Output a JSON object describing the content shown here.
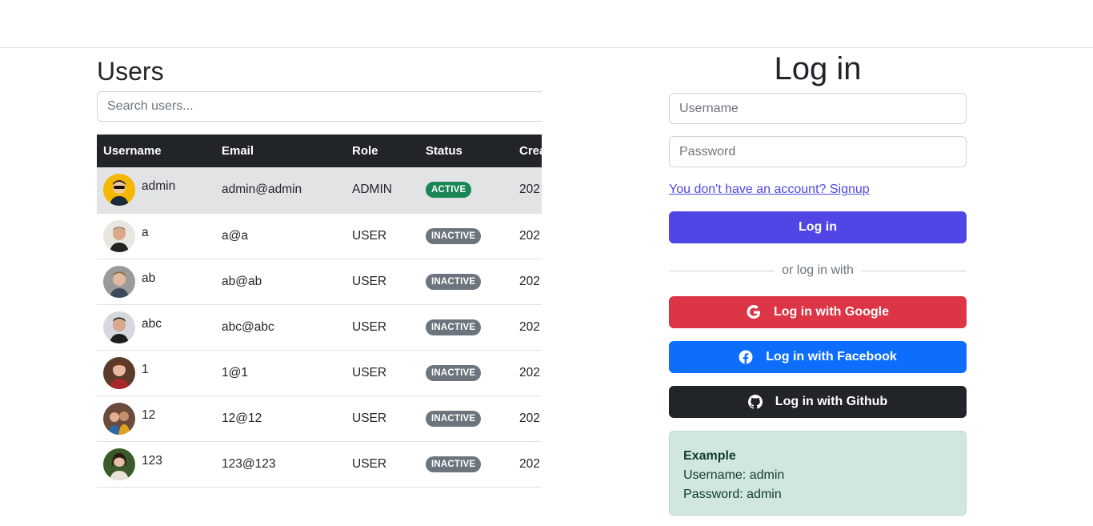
{
  "users": {
    "title": "Users",
    "search_placeholder": "Search users...",
    "columns": [
      "Username",
      "Email",
      "Role",
      "Status",
      "Created"
    ],
    "rows": [
      {
        "username": "admin",
        "email": "admin@admin",
        "role": "ADMIN",
        "status": "ACTIVE",
        "created": "202",
        "avatar": "avatar-admin"
      },
      {
        "username": "a",
        "email": "a@a",
        "role": "USER",
        "status": "INACTIVE",
        "created": "202",
        "avatar": "avatar-a"
      },
      {
        "username": "ab",
        "email": "ab@ab",
        "role": "USER",
        "status": "INACTIVE",
        "created": "202",
        "avatar": "avatar-ab"
      },
      {
        "username": "abc",
        "email": "abc@abc",
        "role": "USER",
        "status": "INACTIVE",
        "created": "202",
        "avatar": "avatar-abc"
      },
      {
        "username": "1",
        "email": "1@1",
        "role": "USER",
        "status": "INACTIVE",
        "created": "202",
        "avatar": "avatar-1"
      },
      {
        "username": "12",
        "email": "12@12",
        "role": "USER",
        "status": "INACTIVE",
        "created": "202",
        "avatar": "avatar-12"
      },
      {
        "username": "123",
        "email": "123@123",
        "role": "USER",
        "status": "INACTIVE",
        "created": "202",
        "avatar": "avatar-123"
      }
    ]
  },
  "login": {
    "title": "Log in",
    "username_placeholder": "Username",
    "password_placeholder": "Password",
    "signup_link": "You don't have an account? Signup",
    "login_button": "Log in",
    "divider_text": "or log in with",
    "google_button": "Log in with Google",
    "facebook_button": "Log in with Facebook",
    "github_button": "Log in with Github",
    "example": {
      "title": "Example",
      "username_line": "Username: admin",
      "password_line": "Password: admin"
    }
  },
  "colors": {
    "primary": "#4f46e5",
    "google": "#dc3545",
    "facebook": "#0d6efd",
    "github": "#212529",
    "active_badge": "#198754",
    "inactive_badge": "#6c757d",
    "table_header": "#212529",
    "example_bg": "#d1e7dd"
  }
}
